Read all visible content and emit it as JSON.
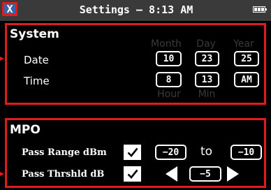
{
  "header": {
    "close_label": "X",
    "title": "Settings – 8:13 AM",
    "battery_icon": "battery-full-icon"
  },
  "system": {
    "title": "System",
    "columns": {
      "month": "Month",
      "day": "Day",
      "year": "Year",
      "hour": "Hour",
      "min": "Min"
    },
    "date": {
      "label": "Date",
      "month": "10",
      "day": "23",
      "year": "25"
    },
    "time": {
      "label": "Time",
      "hour": "8",
      "min": "13",
      "ampm": "AM"
    }
  },
  "mpo": {
    "title": "MPO",
    "pass_range": {
      "label": "Pass Range dBm",
      "checked": true,
      "min": "−20",
      "to": "to",
      "max": "−10"
    },
    "pass_threshold": {
      "label": "Pass Thrshld dB",
      "checked": true,
      "value": "−5"
    }
  },
  "colors": {
    "highlight": "#e01b1b",
    "titlebar": "#3a3a3a",
    "close_bg": "#3b63a8",
    "dim_text": "#3a3a3a"
  }
}
